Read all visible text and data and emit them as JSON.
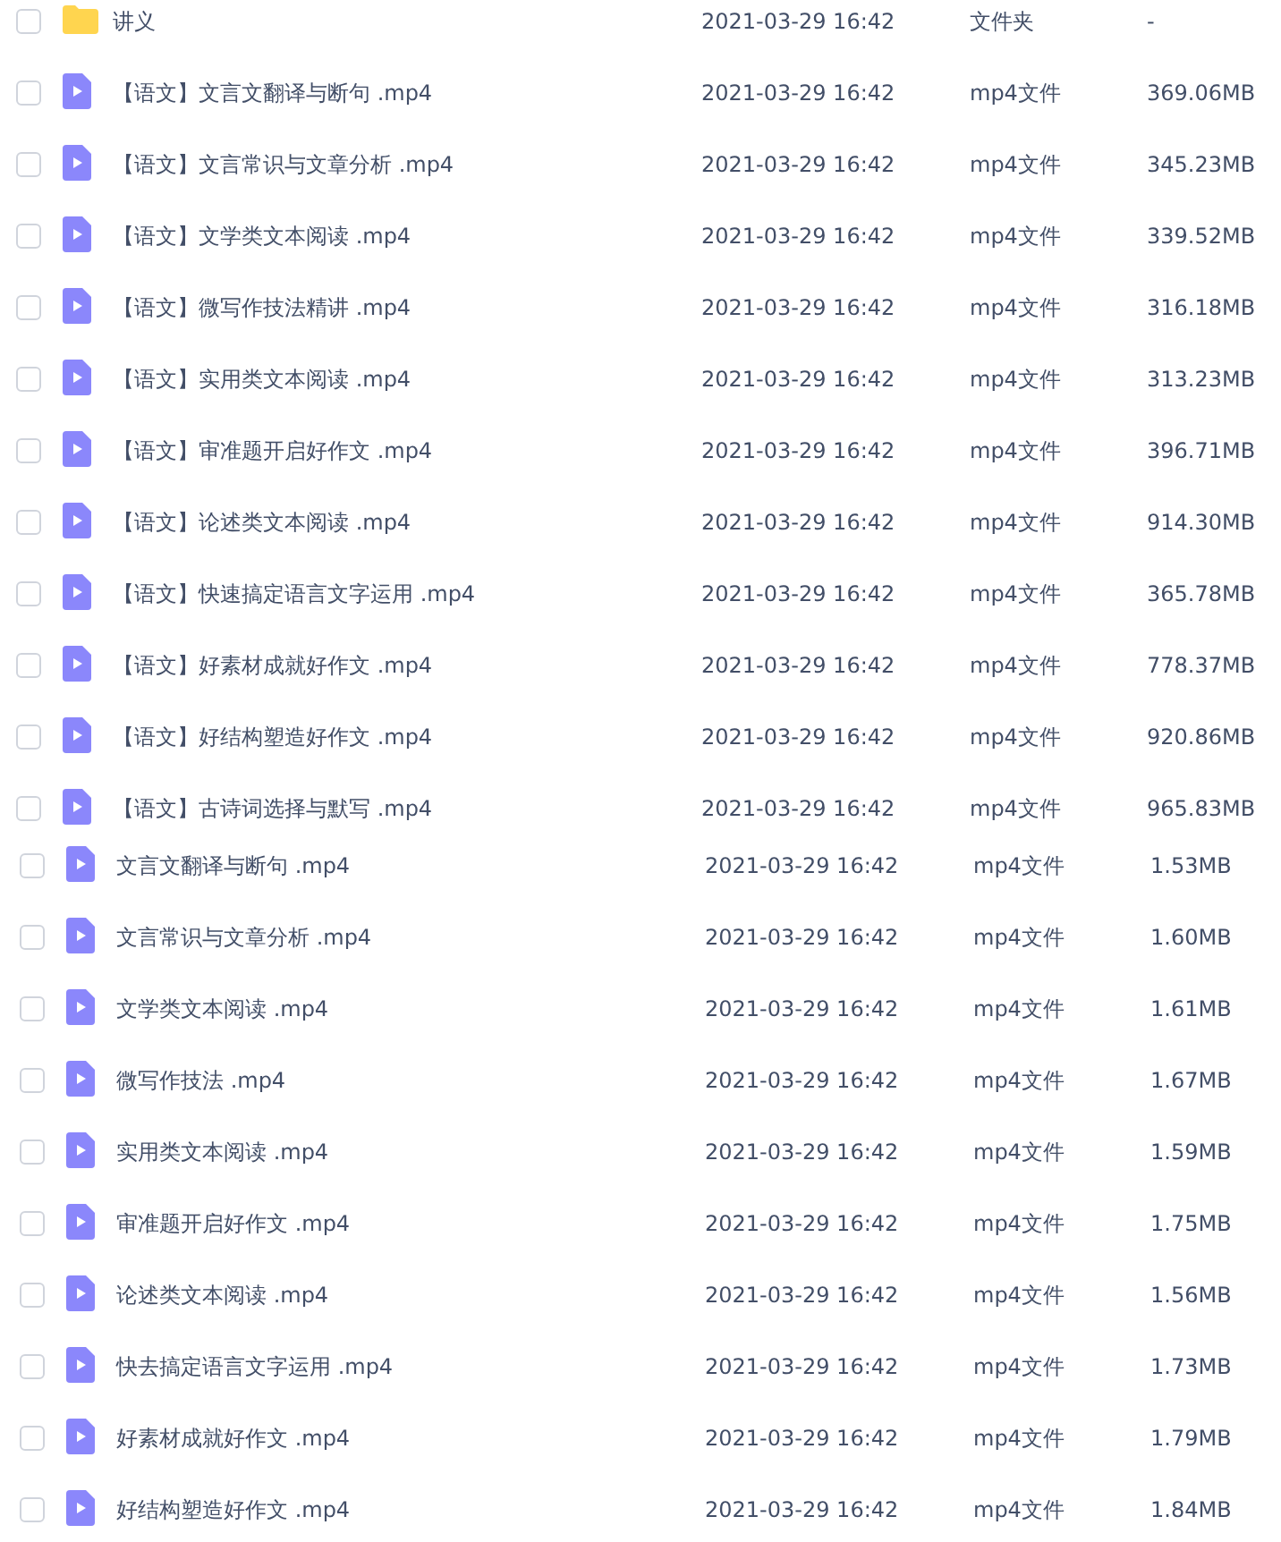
{
  "file_lists": [
    {
      "rows": [
        {
          "kind": "folder",
          "name": "讲义",
          "modified": "2021-03-29 16:42",
          "type": "文件夹",
          "size": "-",
          "checked": false
        },
        {
          "kind": "video",
          "name": "【语文】文言文翻译与断句 .mp4",
          "modified": "2021-03-29 16:42",
          "type": "mp4文件",
          "size": "369.06MB",
          "checked": false
        },
        {
          "kind": "video",
          "name": "【语文】文言常识与文章分析 .mp4",
          "modified": "2021-03-29 16:42",
          "type": "mp4文件",
          "size": "345.23MB",
          "checked": false
        },
        {
          "kind": "video",
          "name": "【语文】文学类文本阅读 .mp4",
          "modified": "2021-03-29 16:42",
          "type": "mp4文件",
          "size": "339.52MB",
          "checked": false
        },
        {
          "kind": "video",
          "name": "【语文】微写作技法精讲 .mp4",
          "modified": "2021-03-29 16:42",
          "type": "mp4文件",
          "size": "316.18MB",
          "checked": false
        },
        {
          "kind": "video",
          "name": "【语文】实用类文本阅读 .mp4",
          "modified": "2021-03-29 16:42",
          "type": "mp4文件",
          "size": "313.23MB",
          "checked": false
        },
        {
          "kind": "video",
          "name": "【语文】审准题开启好作文 .mp4",
          "modified": "2021-03-29 16:42",
          "type": "mp4文件",
          "size": "396.71MB",
          "checked": false
        },
        {
          "kind": "video",
          "name": "【语文】论述类文本阅读 .mp4",
          "modified": "2021-03-29 16:42",
          "type": "mp4文件",
          "size": "914.30MB",
          "checked": false
        },
        {
          "kind": "video",
          "name": "【语文】快速搞定语言文字运用 .mp4",
          "modified": "2021-03-29 16:42",
          "type": "mp4文件",
          "size": "365.78MB",
          "checked": false
        },
        {
          "kind": "video",
          "name": "【语文】好素材成就好作文 .mp4",
          "modified": "2021-03-29 16:42",
          "type": "mp4文件",
          "size": "778.37MB",
          "checked": false
        },
        {
          "kind": "video",
          "name": "【语文】好结构塑造好作文 .mp4",
          "modified": "2021-03-29 16:42",
          "type": "mp4文件",
          "size": "920.86MB",
          "checked": false
        },
        {
          "kind": "video",
          "name": "【语文】古诗词选择与默写 .mp4",
          "modified": "2021-03-29 16:42",
          "type": "mp4文件",
          "size": "965.83MB",
          "checked": false
        }
      ]
    },
    {
      "rows": [
        {
          "kind": "video",
          "name": "文言文翻译与断句 .mp4",
          "modified": "2021-03-29 16:42",
          "type": "mp4文件",
          "size": "1.53MB",
          "checked": false
        },
        {
          "kind": "video",
          "name": "文言常识与文章分析 .mp4",
          "modified": "2021-03-29 16:42",
          "type": "mp4文件",
          "size": "1.60MB",
          "checked": false
        },
        {
          "kind": "video",
          "name": "文学类文本阅读 .mp4",
          "modified": "2021-03-29 16:42",
          "type": "mp4文件",
          "size": "1.61MB",
          "checked": false
        },
        {
          "kind": "video",
          "name": "微写作技法 .mp4",
          "modified": "2021-03-29 16:42",
          "type": "mp4文件",
          "size": "1.67MB",
          "checked": false
        },
        {
          "kind": "video",
          "name": "实用类文本阅读 .mp4",
          "modified": "2021-03-29 16:42",
          "type": "mp4文件",
          "size": "1.59MB",
          "checked": false
        },
        {
          "kind": "video",
          "name": "审准题开启好作文 .mp4",
          "modified": "2021-03-29 16:42",
          "type": "mp4文件",
          "size": "1.75MB",
          "checked": false
        },
        {
          "kind": "video",
          "name": "论述类文本阅读 .mp4",
          "modified": "2021-03-29 16:42",
          "type": "mp4文件",
          "size": "1.56MB",
          "checked": false
        },
        {
          "kind": "video",
          "name": "快去搞定语言文字运用 .mp4",
          "modified": "2021-03-29 16:42",
          "type": "mp4文件",
          "size": "1.73MB",
          "checked": false
        },
        {
          "kind": "video",
          "name": "好素材成就好作文 .mp4",
          "modified": "2021-03-29 16:42",
          "type": "mp4文件",
          "size": "1.79MB",
          "checked": false
        },
        {
          "kind": "video",
          "name": "好结构塑造好作文 .mp4",
          "modified": "2021-03-29 16:42",
          "type": "mp4文件",
          "size": "1.84MB",
          "checked": false
        }
      ]
    }
  ]
}
